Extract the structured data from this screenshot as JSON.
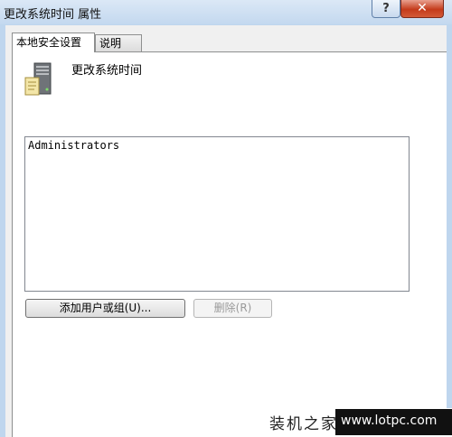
{
  "window": {
    "title": "更改系统时间 属性",
    "help_label": "?",
    "close_label": "✕"
  },
  "tabs": [
    {
      "label": "本地安全设置",
      "selected": true
    },
    {
      "label": "说明",
      "selected": false
    }
  ],
  "policy": {
    "name": "更改系统时间",
    "icon": "server-policy-icon"
  },
  "principals": [
    "Administrators"
  ],
  "buttons": {
    "add_label": "添加用户或组(U)...",
    "remove_label": "删除(R)",
    "remove_enabled": false
  },
  "watermark": {
    "brand": "装机之家",
    "url": "www.lotpc.com"
  },
  "colors": {
    "frame": "#bfd6ee",
    "close": "#c43b1b",
    "disabled_text": "#9a9a9a"
  }
}
